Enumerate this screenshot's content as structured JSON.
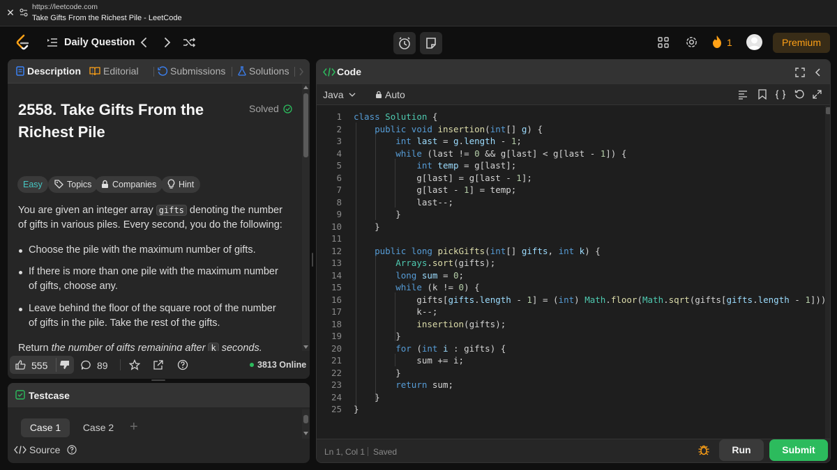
{
  "browser": {
    "url": "https://leetcode.com",
    "title": "Take Gifts From the Richest Pile - LeetCode"
  },
  "nav": {
    "daily_label": "Daily Question",
    "streak": "1",
    "premium_label": "Premium"
  },
  "left_tabs": {
    "description": "Description",
    "editorial": "Editorial",
    "submissions": "Submissions",
    "solutions": "Solutions"
  },
  "problem": {
    "title": "2558. Take Gifts From the Richest Pile",
    "status": "Solved",
    "difficulty": "Easy",
    "chips": {
      "topics": "Topics",
      "companies": "Companies",
      "hint": "Hint"
    },
    "intro_a": "You are given an integer array ",
    "intro_code": "gifts",
    "intro_b": " denoting the number of gifts in various piles. Every second, you do the following:",
    "bullets": [
      "Choose the pile with the maximum number of gifts.",
      "If there is more than one pile with the maximum number of gifts, choose any.",
      "Leave behind the floor of the square root of the number of gifts in the pile. Take the rest of the gifts."
    ],
    "return_a": "Return ",
    "return_italic": "the number of gifts remaining after ",
    "return_code": "k",
    "return_b": " seconds."
  },
  "footer": {
    "likes": "555",
    "comments": "89",
    "online": "3813 Online"
  },
  "testcase": {
    "title": "Testcase",
    "cases": [
      "Case 1",
      "Case 2"
    ],
    "source_label": "Source"
  },
  "code": {
    "title": "Code",
    "language": "Java",
    "mode": "Auto",
    "cursor": "Ln 1, Col 1",
    "saved": "Saved",
    "run_label": "Run",
    "submit_label": "Submit",
    "line_numbers": [
      "1",
      "2",
      "3",
      "4",
      "5",
      "6",
      "7",
      "8",
      "9",
      "10",
      "11",
      "12",
      "13",
      "14",
      "15",
      "16",
      "17",
      "18",
      "19",
      "20",
      "21",
      "22",
      "23",
      "24",
      "25"
    ]
  },
  "colors": {
    "accent": "#ffa116",
    "easy": "#46c6c2",
    "submit": "#2cbb5d",
    "panel": "#262626"
  }
}
